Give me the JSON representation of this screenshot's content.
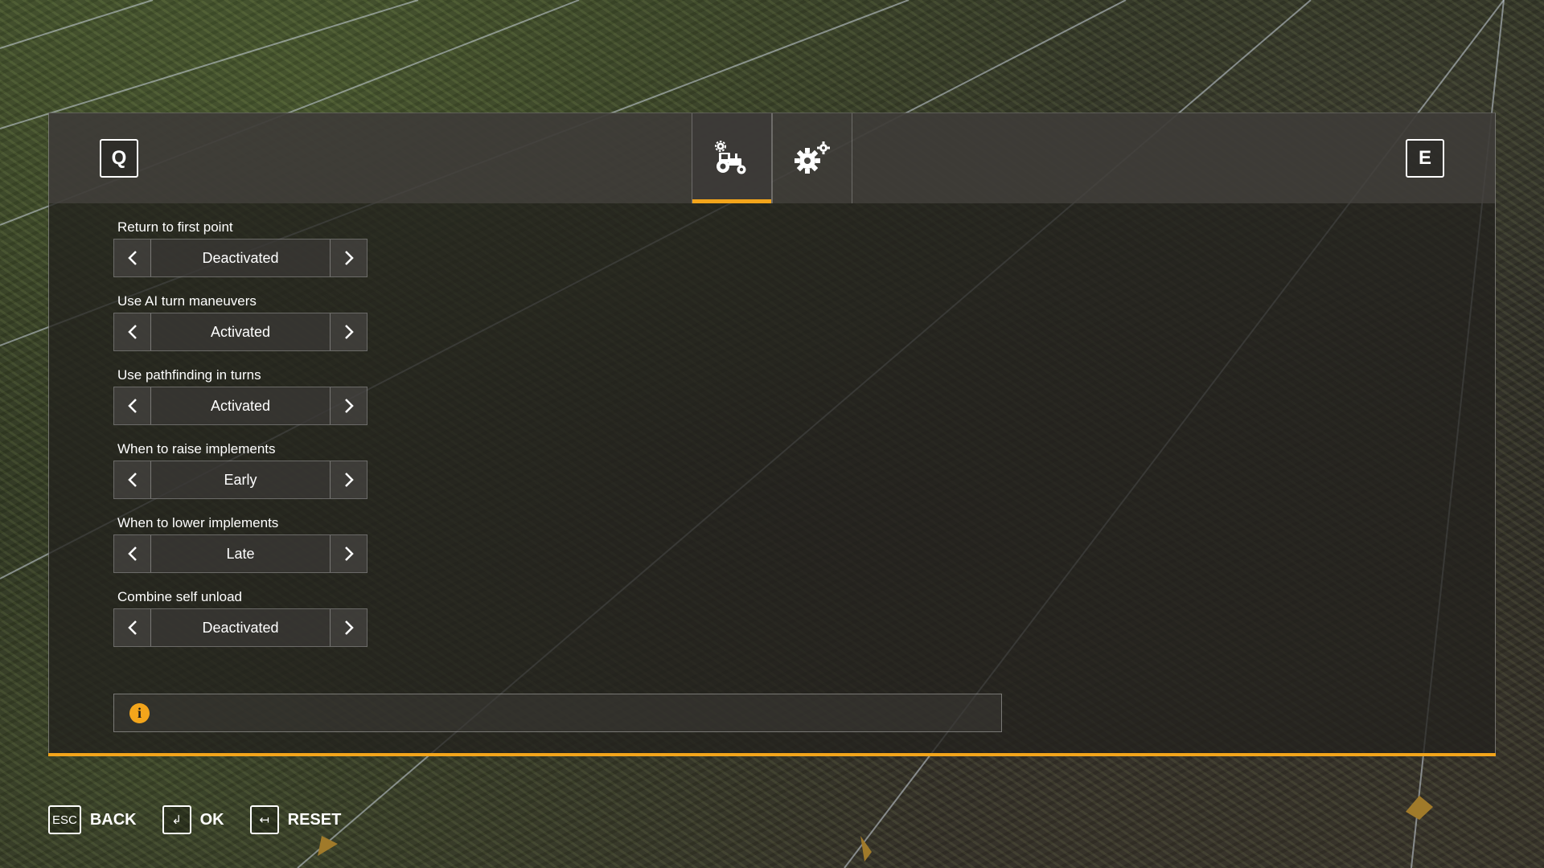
{
  "header": {
    "prev_page_key": "Q",
    "next_page_key": "E",
    "tabs": [
      {
        "icon": "tractor-settings-icon",
        "active": true
      },
      {
        "icon": "gears-icon",
        "active": false
      }
    ]
  },
  "settings": [
    {
      "label": "Return to first point",
      "value": "Deactivated"
    },
    {
      "label": "Use AI turn maneuvers",
      "value": "Activated"
    },
    {
      "label": "Use pathfinding in turns",
      "value": "Activated"
    },
    {
      "label": "When to raise implements",
      "value": "Early"
    },
    {
      "label": "When to lower implements",
      "value": "Late"
    },
    {
      "label": "Combine self unload",
      "value": "Deactivated"
    }
  ],
  "info": {
    "icon": "info-icon",
    "symbol": "i",
    "text": ""
  },
  "footer": {
    "back": {
      "key": "ESC",
      "label": "BACK"
    },
    "ok": {
      "key": "↲",
      "label": "OK"
    },
    "reset": {
      "key": "↤",
      "label": "RESET"
    }
  },
  "colors": {
    "accent": "#f3a51b",
    "panel": "#23211e",
    "text": "#ffffff"
  }
}
